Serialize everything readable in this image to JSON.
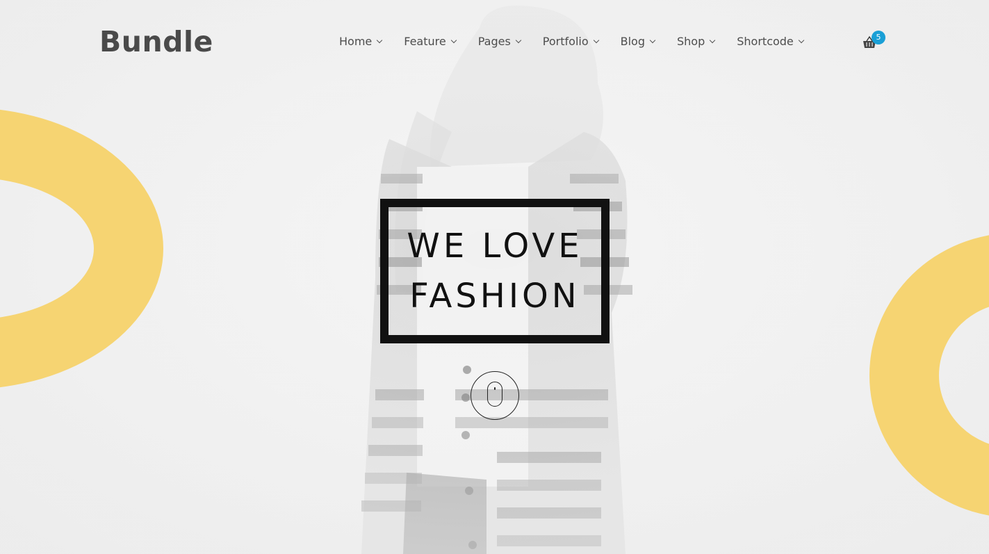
{
  "brand": {
    "name": "Bundle"
  },
  "nav": {
    "items": [
      {
        "label": "Home"
      },
      {
        "label": "Feature"
      },
      {
        "label": "Pages"
      },
      {
        "label": "Portfolio"
      },
      {
        "label": "Blog"
      },
      {
        "label": "Shop"
      },
      {
        "label": "Shortcode"
      }
    ]
  },
  "cart": {
    "icon": "basket-icon",
    "count": "5"
  },
  "hero": {
    "line1": "WE LOVE",
    "line2": "FASHION",
    "scroll_icon": "mouse-scroll-icon"
  },
  "colors": {
    "accent_yellow": "#f6d472",
    "badge_blue": "#1a9fd6",
    "text_dark": "#111111",
    "nav_text": "#4d4d4d",
    "background": "#efefef"
  }
}
